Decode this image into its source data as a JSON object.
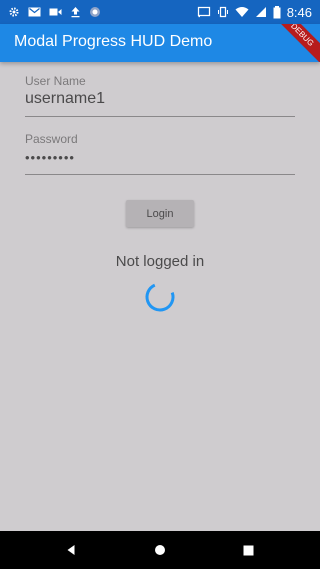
{
  "status_bar": {
    "time": "8:46",
    "left_icons": [
      "settings-icon",
      "gmail-icon",
      "video-icon",
      "upload-icon",
      "sync-icon"
    ],
    "right_icons": [
      "cast-icon",
      "vibrate-icon",
      "wifi-icon",
      "signal-icon",
      "battery-icon"
    ]
  },
  "app_bar": {
    "title": "Modal Progress HUD Demo",
    "debug_banner": "DEBUG",
    "color": "#1e88e5"
  },
  "form": {
    "username_label": "User Name",
    "username_value": "username1",
    "password_label": "Password",
    "password_value": "•••••••••"
  },
  "login_button": {
    "label": "Login"
  },
  "status": {
    "text": "Not logged in"
  },
  "progress": {
    "indicator": "circular-spinner",
    "color": "#2196f3"
  },
  "navigation": {
    "buttons": [
      "back-icon",
      "home-icon",
      "recents-icon"
    ]
  }
}
